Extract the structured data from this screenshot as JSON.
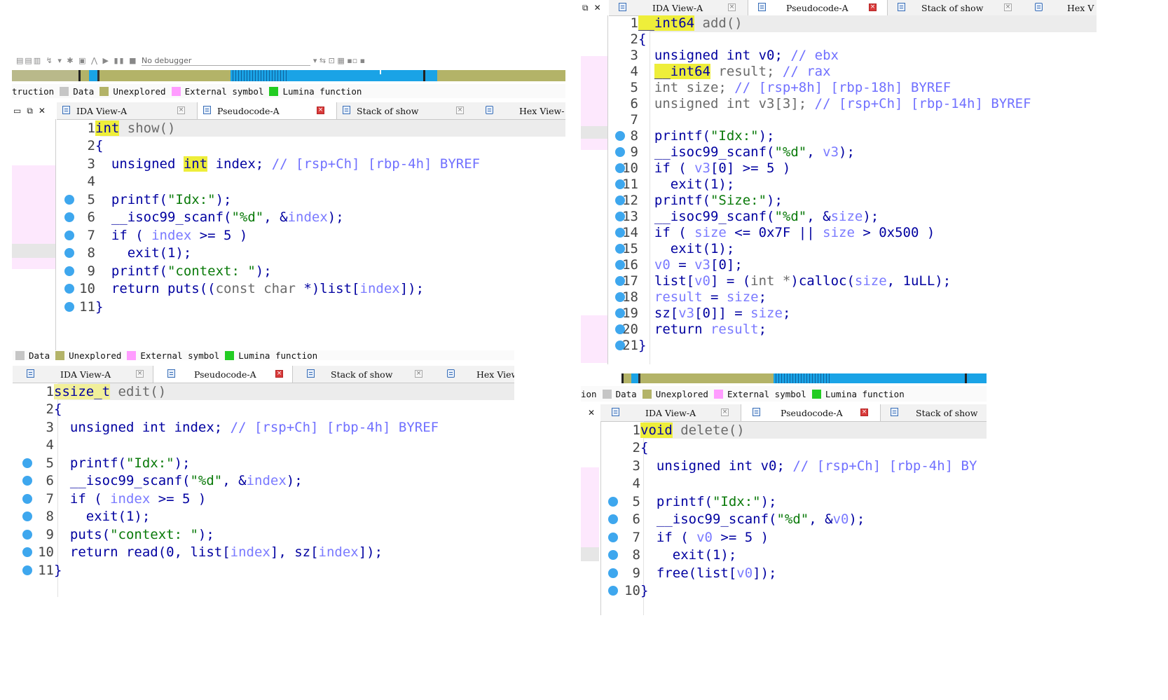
{
  "tabs": {
    "ida_view": "IDA View-A",
    "pseudocode": "Pseudocode-A",
    "stack": "Stack of show",
    "hex_full": "Hex View-",
    "hex_tr": "Hex V",
    "hex_bl": "Hex View"
  },
  "legend": {
    "instruction_tl": "truction",
    "instruction_br": "ion",
    "data": "Data",
    "unexplored": "Unexplored",
    "external": "External symbol",
    "lumina": "Lumina function"
  },
  "toolbar": {
    "debugger": "No debugger"
  },
  "colors": {
    "data": "#c6c6c6",
    "unexplored": "#b3b368",
    "external": "#ff9cff",
    "lumina": "#22cc22",
    "code_blue": "#1aa3e6",
    "dot": "#3ea7ee"
  },
  "show": {
    "nums": [
      "1",
      "2",
      "3",
      "4",
      "5",
      "6",
      "7",
      "8",
      "9",
      "10",
      "11"
    ],
    "l1": {
      "type": "int",
      "name": " show()"
    },
    "l2": "{",
    "l3": {
      "a": "  unsigned ",
      "b": "int",
      "c": " index; ",
      "d": "// [rsp+Ch] [rbp-4h] BYREF"
    },
    "l5": {
      "a": "  printf(",
      "b": "\"Idx:\"",
      "c": ");"
    },
    "l6": {
      "a": "  __isoc99_scanf(",
      "b": "\"%d\"",
      "c": ", &",
      "d": "index",
      "e": ");"
    },
    "l7": {
      "a": "  if ( ",
      "b": "index",
      "c": " >= 5 )"
    },
    "l8": "    exit(1);",
    "l9": {
      "a": "  printf(",
      "b": "\"context: \"",
      "c": ");"
    },
    "l10": {
      "a": "  return puts((",
      "b": "const char",
      "c": " *)list[",
      "d": "index",
      "e": "]);"
    },
    "l11": "}"
  },
  "add": {
    "nums": [
      "1",
      "2",
      "3",
      "4",
      "5",
      "6",
      "7",
      "8",
      "9",
      "10",
      "11",
      "12",
      "13",
      "14",
      "15",
      "16",
      "17",
      "18",
      "19",
      "20",
      "21"
    ],
    "l1": {
      "type": "__int64",
      "name": " add()"
    },
    "l2": "{",
    "l3": {
      "a": "  unsigned int v0; ",
      "b": "// ebx"
    },
    "l4": {
      "a": "  ",
      "t": "__int64",
      "b": " result; ",
      "c": "// rax"
    },
    "l5": {
      "a": "  int size; ",
      "b": "// [rsp+8h] [rbp-18h] BYREF"
    },
    "l6": {
      "a": "  unsigned int v3[3]; ",
      "b": "// [rsp+Ch] [rbp-14h] BYREF"
    },
    "l8": {
      "a": "  printf(",
      "b": "\"Idx:\"",
      "c": ");"
    },
    "l9": {
      "a": "  __isoc99_scanf(",
      "b": "\"%d\"",
      "c": ", ",
      "d": "v3",
      "e": ");"
    },
    "l10": {
      "a": "  if ( ",
      "b": "v3",
      "c": "[0] >= 5 )"
    },
    "l11": "    exit(1);",
    "l12": {
      "a": "  printf(",
      "b": "\"Size:\"",
      "c": ");"
    },
    "l13": {
      "a": "  __isoc99_scanf(",
      "b": "\"%d\"",
      "c": ", &",
      "d": "size",
      "e": ");"
    },
    "l14": {
      "a": "  if ( ",
      "b": "size",
      "c": " <= 0x7F || ",
      "d": "size",
      "e": " > 0x500 )"
    },
    "l15": "    exit(1);",
    "l16": {
      "a": "  ",
      "b": "v0",
      "c": " = ",
      "d": "v3",
      "e": "[0];"
    },
    "l17": {
      "a": "  list[",
      "b": "v0",
      "c": "] = (",
      "d": "int *",
      "e": ")calloc(",
      "f": "size",
      "g": ", 1uLL);"
    },
    "l18": {
      "a": "  ",
      "b": "result",
      "c": " = ",
      "d": "size",
      "e": ";"
    },
    "l19": {
      "a": "  sz[",
      "b": "v3",
      "c": "[0]] = ",
      "d": "size",
      "e": ";"
    },
    "l20": {
      "a": "  return ",
      "b": "result",
      "c": ";"
    },
    "l21": "}"
  },
  "edit": {
    "nums": [
      "1",
      "2",
      "3",
      "4",
      "5",
      "6",
      "7",
      "8",
      "9",
      "10",
      "11"
    ],
    "l1": {
      "type": "ssize_t",
      "name": " edit()"
    },
    "l2": "{",
    "l3": {
      "a": "  unsigned int index; ",
      "b": "// [rsp+Ch] [rbp-4h] BYREF"
    },
    "l5": {
      "a": "  printf(",
      "b": "\"Idx:\"",
      "c": ");"
    },
    "l6": {
      "a": "  __isoc99_scanf(",
      "b": "\"%d\"",
      "c": ", &",
      "d": "index",
      "e": ");"
    },
    "l7": {
      "a": "  if ( ",
      "b": "index",
      "c": " >= 5 )"
    },
    "l8": "    exit(1);",
    "l9": {
      "a": "  puts(",
      "b": "\"context: \"",
      "c": ");"
    },
    "l10": {
      "a": "  return read(0, list[",
      "b": "index",
      "c": "], sz[",
      "d": "index",
      "e": "]);"
    },
    "l11": "}"
  },
  "delete": {
    "nums": [
      "1",
      "2",
      "3",
      "4",
      "5",
      "6",
      "7",
      "8",
      "9",
      "10"
    ],
    "l1": {
      "type": "void",
      "name": " delete()"
    },
    "l2": "{",
    "l3": {
      "a": "  unsigned int v0; ",
      "b": "// [rsp+Ch] [rbp-4h] BY"
    },
    "l5": {
      "a": "  printf(",
      "b": "\"Idx:\"",
      "c": ");"
    },
    "l6": {
      "a": "  __isoc99_scanf(",
      "b": "\"%d\"",
      "c": ", &",
      "d": "v0",
      "e": ");"
    },
    "l7": {
      "a": "  if ( ",
      "b": "v0",
      "c": " >= 5 )"
    },
    "l8": "    exit(1);",
    "l9": {
      "a": "  free(list[",
      "b": "v0",
      "c": "]);"
    },
    "l10": "}"
  }
}
